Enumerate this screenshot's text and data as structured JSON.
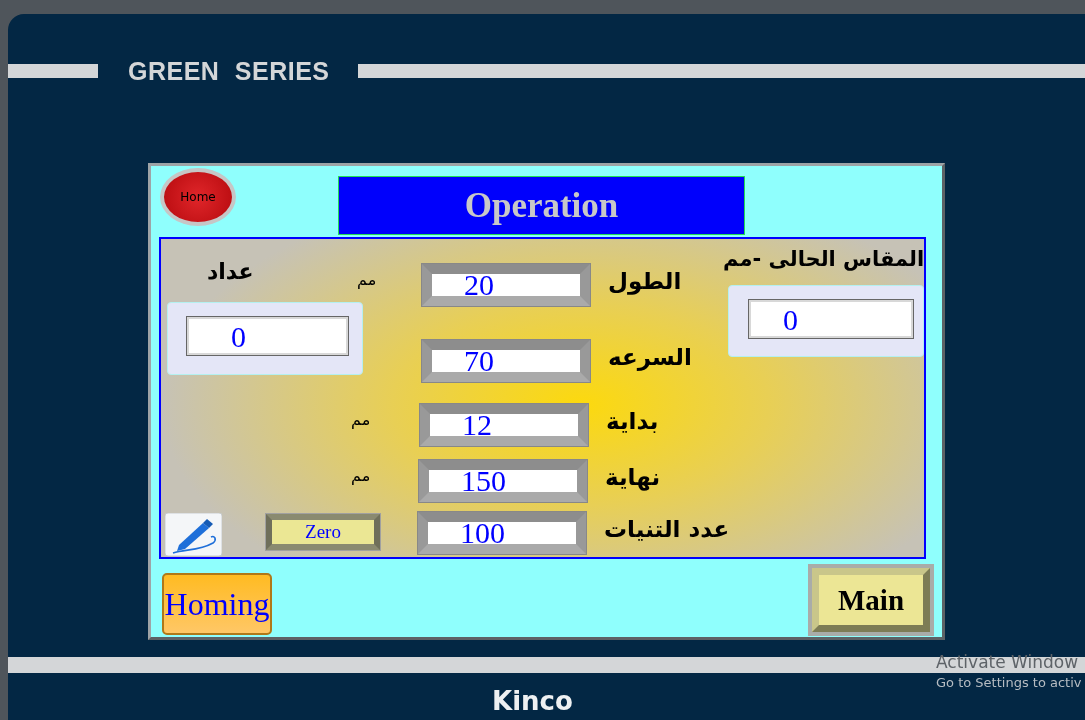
{
  "device": {
    "series": "GREEN SERIES",
    "brand": "Kinco"
  },
  "screen": {
    "home_button": "Home",
    "title": "Operation",
    "counter": {
      "label": "عداد",
      "value": "0"
    },
    "current_size": {
      "label": "المقاس الحالى -مم",
      "value": "0"
    },
    "parameters": [
      {
        "label": "الطول",
        "value": "20",
        "unit": "مم"
      },
      {
        "label": "السرعه",
        "value": "70"
      },
      {
        "label": "بداية",
        "value": "12",
        "unit": "مم"
      },
      {
        "label": "نهاية",
        "value": "150",
        "unit": "مم"
      },
      {
        "label": "عدد التنيات",
        "value": "100"
      }
    ],
    "zero_button": "Zero",
    "homing_button": "Homing",
    "main_button": "Main"
  },
  "os_notice": {
    "title": "Activate Window",
    "text": "Go to Settings to activ"
  }
}
